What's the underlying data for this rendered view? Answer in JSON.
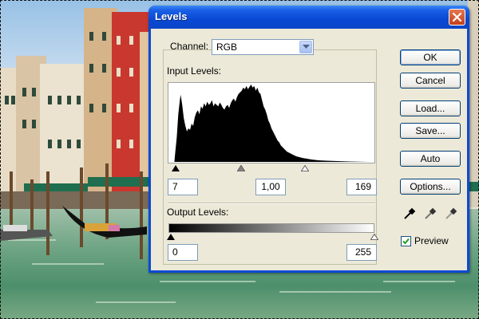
{
  "dialog": {
    "title": "Levels",
    "channel_label": "Channel:",
    "channel_value": "RGB",
    "input_levels_label": "Input Levels:",
    "output_levels_label": "Output Levels:",
    "input_black": "7",
    "input_gamma": "1,00",
    "input_white": "169",
    "output_black": "0",
    "output_white": "255"
  },
  "buttons": {
    "ok": "OK",
    "cancel": "Cancel",
    "load": "Load...",
    "save": "Save...",
    "auto": "Auto",
    "options": "Options..."
  },
  "preview": {
    "label": "Preview",
    "checked": true
  },
  "icons": [
    "close-icon",
    "dropdown-arrow-icon",
    "black-eyedropper-icon",
    "gray-eyedropper-icon",
    "white-eyedropper-icon"
  ],
  "colors": {
    "titlebar": "#0a48d4",
    "dialog_face": "#ece9d8",
    "close_button": "#c3401a"
  }
}
